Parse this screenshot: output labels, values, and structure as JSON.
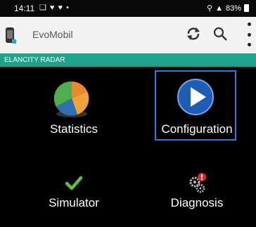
{
  "status_bar": {
    "time": "14:11",
    "notifications": "❑ ♥ ♥ •",
    "indicators": "▼ ↓↑▕▓",
    "battery": "83%"
  },
  "app_bar": {
    "title": "EvoMobil",
    "icons": [
      "phone-logo",
      "refresh-icon",
      "search-icon",
      "more-vert-icon"
    ]
  },
  "section": {
    "label": "ELANCITY RADAR",
    "color": "#1fa38a"
  },
  "tiles": [
    {
      "label": "Statistics",
      "icon": "pie-chart-icon"
    },
    {
      "label": "Configuration",
      "icon": "play-icon",
      "selected": true
    },
    {
      "label": "Simulator",
      "icon": "checkmark-icon"
    },
    {
      "label": "Diagnosis",
      "icon": "gears-alert-icon"
    }
  ],
  "colors": {
    "accent_teal": "#1fa38a",
    "selection_border": "#2d7ed8",
    "background": "#000000"
  }
}
